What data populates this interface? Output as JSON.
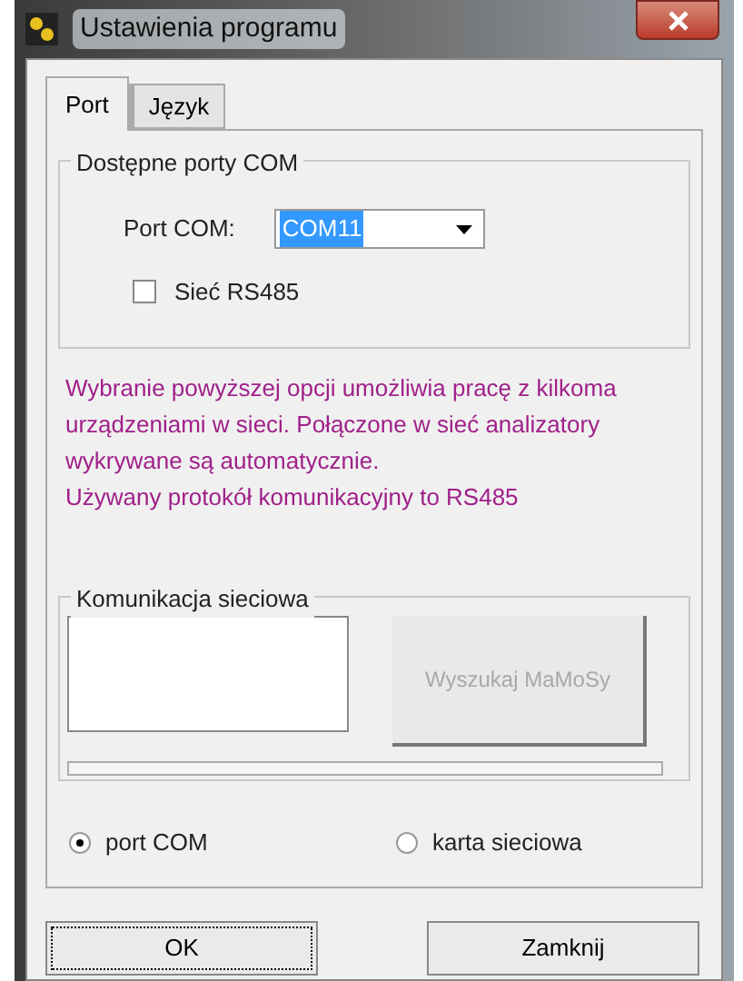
{
  "window": {
    "title": "Ustawienia programu"
  },
  "tabs": [
    {
      "label": "Port",
      "selected": true
    },
    {
      "label": "Język",
      "selected": false
    }
  ],
  "ports_group": {
    "title": "Dostępne porty COM",
    "port_label": "Port COM:",
    "port_value": "COM11",
    "rs485": {
      "label": "Sieć RS485",
      "checked": false
    }
  },
  "info_lines": [
    "Wybranie powyższej opcji umożliwia pracę z kilkoma",
    "urządzeniami w sieci. Połączone w sieć analizatory",
    "wykrywane są automatycznie.",
    "Używany protokół komunikacyjny to RS485"
  ],
  "network_group": {
    "title": "Komunikacja sieciowa",
    "search_button": {
      "label": "Wyszukaj MaMoSy",
      "disabled": true
    }
  },
  "connection": [
    {
      "label": "port COM",
      "selected": true
    },
    {
      "label": "karta sieciowa",
      "selected": false
    }
  ],
  "buttons": [
    {
      "label": "OK",
      "focused": true
    },
    {
      "label": "Zamknij",
      "focused": false
    }
  ]
}
